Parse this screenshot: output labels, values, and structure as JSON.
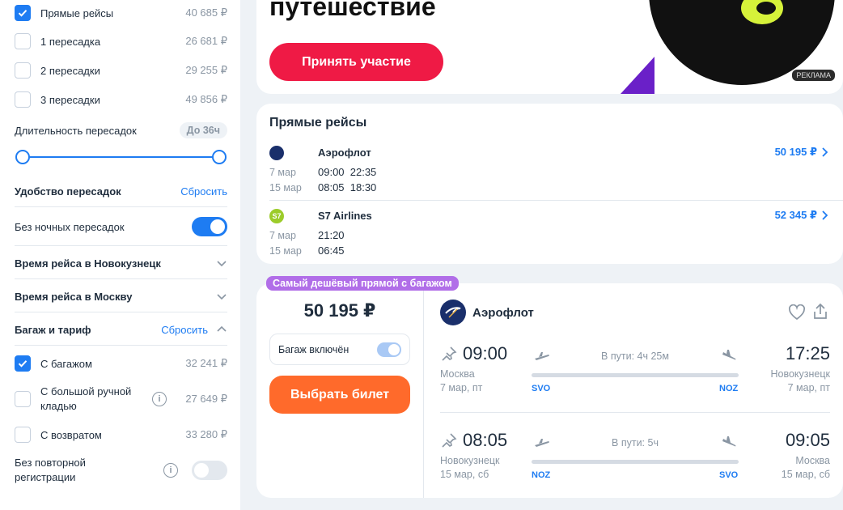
{
  "sidebar": {
    "stops": [
      {
        "label": "Прямые рейсы",
        "price": "40 685 ₽",
        "checked": true
      },
      {
        "label": "1 пересадка",
        "price": "26 681 ₽",
        "checked": false
      },
      {
        "label": "2 пересадки",
        "price": "29 255 ₽",
        "checked": false
      },
      {
        "label": "3 пересадки",
        "price": "49 856 ₽",
        "checked": false
      }
    ],
    "layover_duration": {
      "label": "Длительность пересадок",
      "value": "До 36ч"
    },
    "comfort": {
      "title": "Удобство пересадок",
      "reset": "Сбросить",
      "no_night_label": "Без ночных пересадок",
      "no_night_on": true
    },
    "time_novokuznetsk": "Время рейса в Новокузнецк",
    "time_moscow": "Время рейса в Москву",
    "baggage": {
      "title": "Багаж и тариф",
      "reset": "Сбросить",
      "options": [
        {
          "label": "С багажом",
          "price": "32 241 ₽",
          "checked": true
        },
        {
          "label": "С большой ручной кладью",
          "price": "27 649 ₽",
          "checked": false
        },
        {
          "label": "С возвратом",
          "price": "33 280 ₽",
          "checked": false
        }
      ],
      "no_recheck_label": "Без повторной регистрации",
      "no_recheck_on": false
    }
  },
  "banner": {
    "title": "путешествие",
    "button": "Принять участие",
    "ad_label": "РЕКЛАМА"
  },
  "direct_flights": {
    "title": "Прямые рейсы",
    "items": [
      {
        "airline": "Аэрофлот",
        "price": "50 195 ₽",
        "out_date": "7 мар",
        "out_times": "09:00  22:35",
        "ret_date": "15 мар",
        "ret_times": "08:05  18:30"
      },
      {
        "airline": "S7 Airlines",
        "price": "52 345 ₽",
        "out_date": "7 мар",
        "out_times": "21:20",
        "ret_date": "15 мар",
        "ret_times": "06:45"
      }
    ]
  },
  "ticket": {
    "badge": "Самый дешёвый прямой с багажом",
    "price": "50 195 ₽",
    "baggage_label": "Багаж включён",
    "buy_button": "Выбрать билет",
    "airline": "Аэрофлот",
    "outbound": {
      "dep_time": "09:00",
      "arr_time": "17:25",
      "dep_city": "Москва",
      "dep_date": "7 мар, пт",
      "arr_city": "Новокузнецк",
      "arr_date": "7 мар, пт",
      "duration": "В пути: 4ч 25м",
      "from": "SVO",
      "to": "NOZ"
    },
    "return": {
      "dep_time": "08:05",
      "arr_time": "09:05",
      "dep_city": "Новокузнецк",
      "dep_date": "15 мар, сб",
      "arr_city": "Москва",
      "arr_date": "15 мар, сб",
      "duration": "В пути: 5ч",
      "from": "NOZ",
      "to": "SVO"
    }
  },
  "colors": {
    "accent": "#1e7cf2",
    "buy": "#ff6a2b",
    "banner_button": "#ef1a45",
    "badge": "#b16ee8"
  }
}
